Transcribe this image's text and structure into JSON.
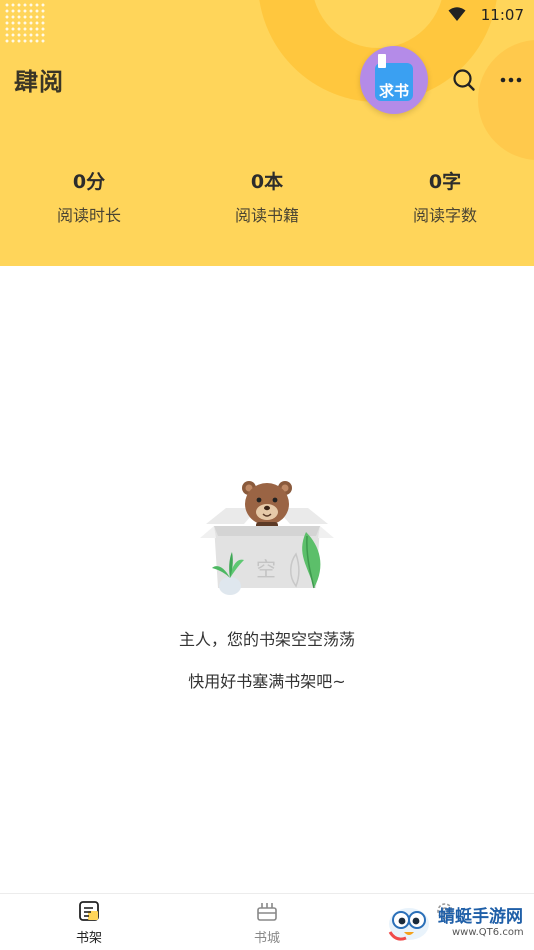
{
  "status_bar": {
    "time": "11:07",
    "wifi_icon": "wifi-icon"
  },
  "header": {
    "app_title": "肆阅",
    "request_button_label": "求书",
    "search_icon": "search-icon",
    "more_icon": "more-icon",
    "background_color": "#ffd55a"
  },
  "stats": [
    {
      "value": "0分",
      "label": "阅读时长"
    },
    {
      "value": "0本",
      "label": "阅读书籍"
    },
    {
      "value": "0字",
      "label": "阅读字数"
    }
  ],
  "empty_state": {
    "box_label": "空",
    "line1": "主人，您的书架空空荡荡",
    "line2": "快用好书塞满书架吧~"
  },
  "tabbar": {
    "items": [
      {
        "label": "书架",
        "icon": "bookshelf-icon",
        "active": true
      },
      {
        "label": "书城",
        "icon": "bookstore-icon",
        "active": false
      },
      {
        "label": "",
        "icon": "settings-icon",
        "active": false
      }
    ],
    "active_color": "#222222",
    "inactive_color": "#888888"
  },
  "watermark": {
    "title": "蜻蜓手游网",
    "url": "www.QT6.com"
  }
}
